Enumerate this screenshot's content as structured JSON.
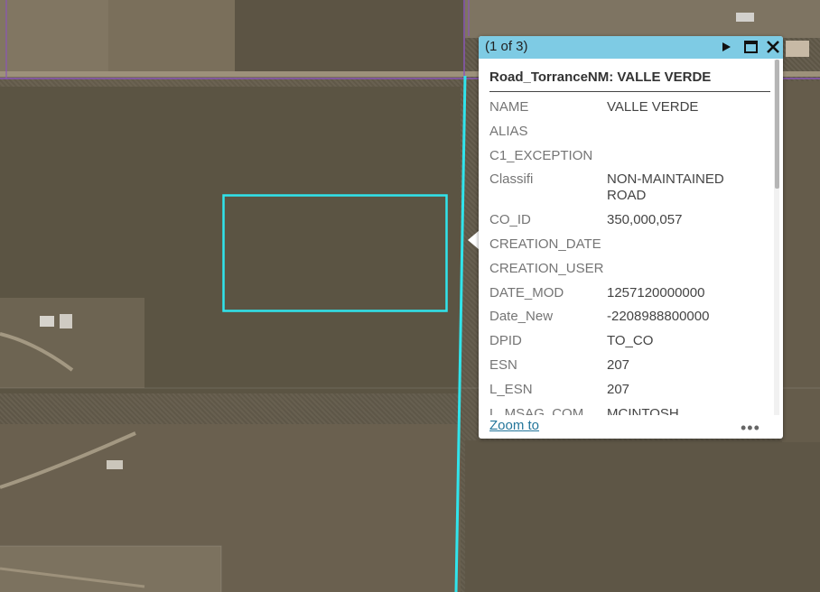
{
  "map": {
    "parcel_line_color": "#8a56b8",
    "highlight_color": "#30e4ec"
  },
  "popup": {
    "pager": "(1 of 3)",
    "next_icon": "play-icon",
    "maximize_icon": "maximize-icon",
    "close_icon": "close-icon",
    "title": "Road_TorranceNM: VALLE VERDE",
    "fields": [
      {
        "key": "NAME",
        "value": "VALLE VERDE"
      },
      {
        "key": "ALIAS",
        "value": ""
      },
      {
        "key": "C1_EXCEPTION",
        "value": ""
      },
      {
        "key": "Classifi",
        "value": "NON-MAINTAINED ROAD"
      },
      {
        "key": "CO_ID",
        "value": "350,000,057"
      },
      {
        "key": "CREATION_DATE",
        "value": ""
      },
      {
        "key": "CREATION_USER",
        "value": ""
      },
      {
        "key": "DATE_MOD",
        "value": "1257120000000"
      },
      {
        "key": "Date_New",
        "value": "-2208988800000"
      },
      {
        "key": "DPID",
        "value": "TO_CO"
      },
      {
        "key": "ESN",
        "value": "207"
      },
      {
        "key": "L_ESN",
        "value": "207"
      },
      {
        "key": "L_MSAG_COM",
        "value": "MCINTOSH"
      }
    ],
    "zoom_to": "Zoom to",
    "more": "•••"
  }
}
